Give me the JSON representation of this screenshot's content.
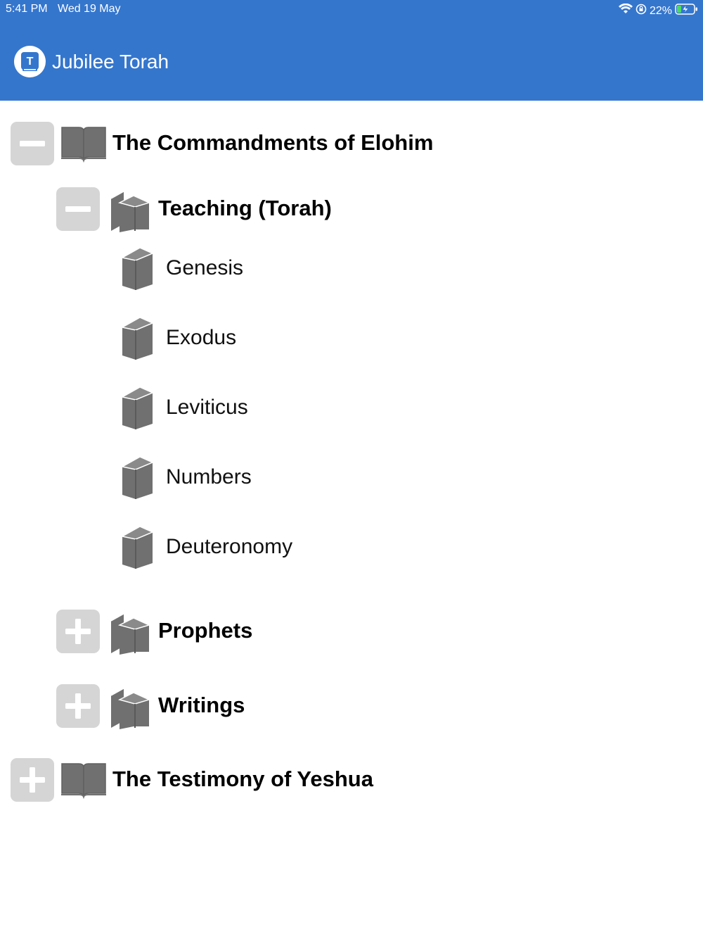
{
  "status_bar": {
    "time": "5:41 PM",
    "date": "Wed 19 May",
    "battery": "22%",
    "icons": [
      "wifi-icon",
      "orientation-lock-icon",
      "battery-charging-icon"
    ]
  },
  "app": {
    "title": "Jubilee Torah",
    "logo_letter": "T",
    "header_color": "#3576cd"
  },
  "tree": {
    "commandments": {
      "label": "The Commandments of Elohim",
      "expanded": true,
      "toggle_icon": "minus-icon",
      "icon": "open-book-icon"
    },
    "teaching": {
      "label": "Teaching (Torah)",
      "expanded": true,
      "toggle_icon": "minus-icon",
      "icon": "books-icon"
    },
    "books": [
      {
        "label": "Genesis",
        "icon": "book-icon"
      },
      {
        "label": "Exodus",
        "icon": "book-icon"
      },
      {
        "label": "Leviticus",
        "icon": "book-icon"
      },
      {
        "label": "Numbers",
        "icon": "book-icon"
      },
      {
        "label": "Deuteronomy",
        "icon": "book-icon"
      }
    ],
    "prophets": {
      "label": "Prophets",
      "expanded": false,
      "toggle_icon": "plus-icon",
      "icon": "books-icon"
    },
    "writings": {
      "label": "Writings",
      "expanded": false,
      "toggle_icon": "plus-icon",
      "icon": "books-icon"
    },
    "testimony": {
      "label": "The Testimony of Yeshua",
      "expanded": false,
      "toggle_icon": "plus-icon",
      "icon": "open-book-icon"
    }
  },
  "colors": {
    "toggle_bg": "#d5d5d5",
    "icon_gray": "#707070"
  }
}
